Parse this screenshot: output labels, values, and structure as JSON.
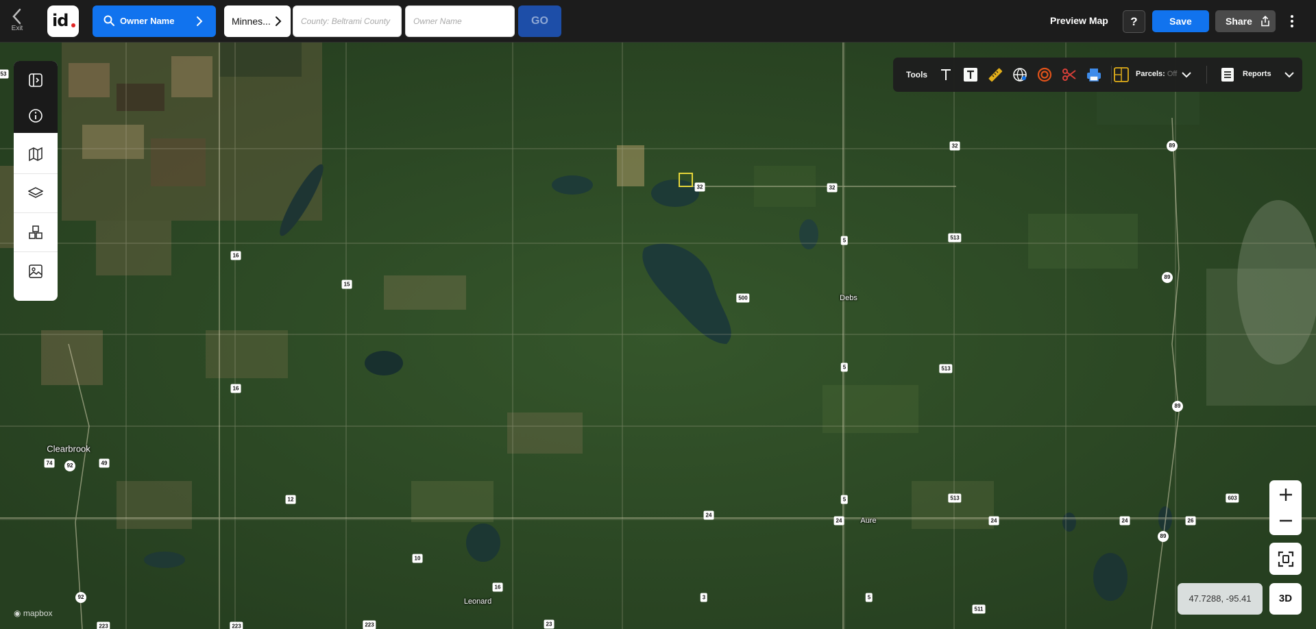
{
  "topbar": {
    "exit_label": "Exit",
    "logo_text": "id",
    "search_mode_label": "Owner Name",
    "state_label": "Minnes...",
    "county_placeholder": "County: Beltrami County",
    "owner_placeholder": "Owner Name",
    "go_label": "GO",
    "preview_label": "Preview Map",
    "help_label": "?",
    "save_label": "Save",
    "share_label": "Share"
  },
  "tools": {
    "label": "Tools",
    "icons": [
      "text-icon",
      "text-box-icon",
      "ruler-icon",
      "globe-icon",
      "radius-icon",
      "scissors-icon",
      "print-icon",
      "parcels-icon"
    ],
    "parcels_label": "Parcels:",
    "parcels_value": "Off",
    "reports_label": "Reports"
  },
  "left_panel": {
    "icons": [
      "sidebar-toggle-icon",
      "info-icon",
      "map-icon",
      "layers-icon",
      "buildings-icon",
      "image-icon"
    ]
  },
  "map": {
    "places": [
      "Clearbrook",
      "Debs",
      "Aure",
      "Leonard"
    ],
    "route_shields": [
      "53",
      "16",
      "15",
      "16",
      "74",
      "92",
      "49",
      "12",
      "10",
      "16",
      "92",
      "223",
      "223",
      "223",
      "23",
      "3",
      "24",
      "32",
      "32",
      "32",
      "5",
      "500",
      "5",
      "513",
      "513",
      "5",
      "24",
      "513",
      "24",
      "5",
      "511",
      "89",
      "89",
      "89",
      "24",
      "26",
      "89",
      "603"
    ],
    "attribution": "mapbox",
    "coordinates": "47.7288, -95.41",
    "btn_3d": "3D"
  },
  "colors": {
    "accent": "#1173ee",
    "go_button": "#1d4ea8",
    "topbar": "#1c1c1c",
    "parcel_highlight": "#e6d63a"
  }
}
